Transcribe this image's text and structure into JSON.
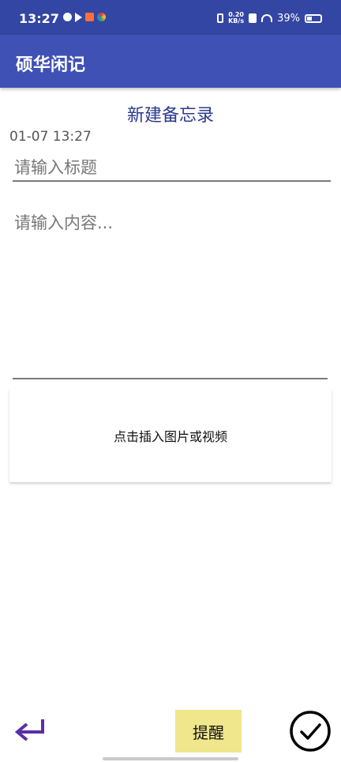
{
  "status_bar": {
    "time": "13:27",
    "net_speed_value": "0.20",
    "net_speed_unit": "KB/s",
    "battery": "39%"
  },
  "app_bar": {
    "title": "硕华闲记"
  },
  "editor": {
    "heading": "新建备忘录",
    "timestamp": "01-07 13:27",
    "title_placeholder": "请输入标题",
    "content_placeholder": "请输入内容..."
  },
  "media": {
    "label": "点击插入图片或视频"
  },
  "bottom_bar": {
    "back_icon": "return-arrow-icon",
    "remind_label": "提醒",
    "confirm_icon": "check-circle-icon"
  },
  "colors": {
    "status_bar": "#3346a3",
    "app_bar": "#3f51b5",
    "heading": "#2b3a8f",
    "remind_button": "#f0e68c",
    "back_arrow": "#5b2ea6"
  }
}
